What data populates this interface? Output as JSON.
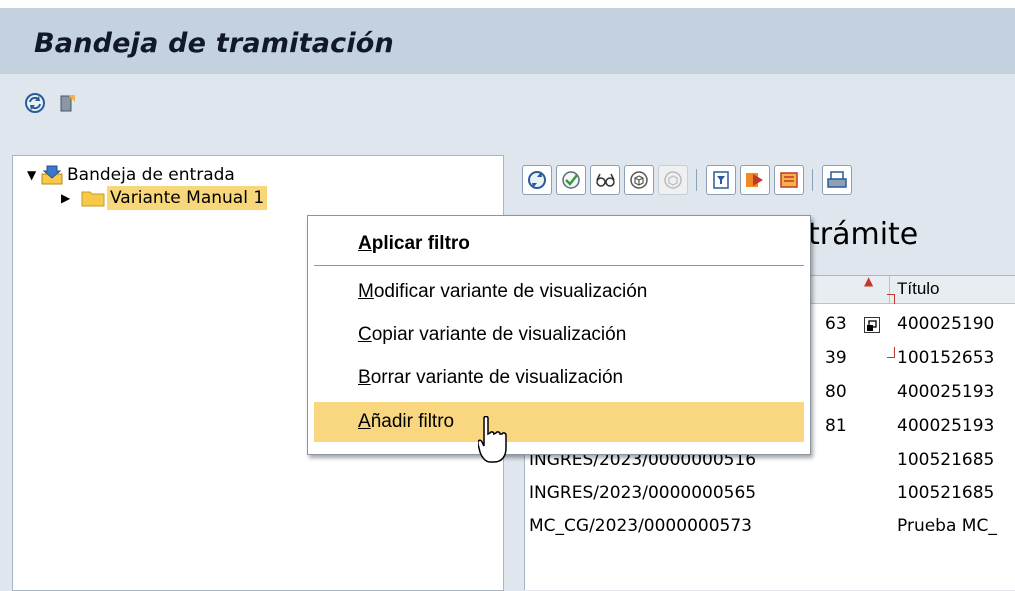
{
  "title": "Bandeja de tramitación",
  "toolbar": {
    "icons": [
      "refresh-icon",
      "exit-icon"
    ]
  },
  "tree": {
    "root_label": "Bandeja de entrada",
    "child_label": "Variante Manual 1"
  },
  "grid": {
    "title_partial": "trámite",
    "col_title": "Título",
    "rows": [
      {
        "id": "63",
        "title": "400025190"
      },
      {
        "id": "39",
        "title": "100152653"
      },
      {
        "id": "80",
        "title": "400025193"
      },
      {
        "id": "81",
        "title": "400025193"
      },
      {
        "id": "INGRES/2023/0000000516",
        "title": "100521685"
      },
      {
        "id": "INGRES/2023/0000000565",
        "title": "100521685"
      },
      {
        "id": "MC_CG/2023/0000000573",
        "title": "Prueba MC_"
      }
    ]
  },
  "context_menu": {
    "items": [
      {
        "first": "A",
        "rest": "plicar filtro"
      },
      {
        "first": "M",
        "rest": "odificar variante de visualización"
      },
      {
        "first": "C",
        "rest": "opiar variante de visualización"
      },
      {
        "first": "B",
        "rest": "orrar variante de visualización"
      },
      {
        "first": "A",
        "rest": "ñadir filtro"
      }
    ]
  },
  "colors": {
    "title_bg": "#c4d2df",
    "highlight": "#f9d780",
    "folder": "#f7c948"
  }
}
